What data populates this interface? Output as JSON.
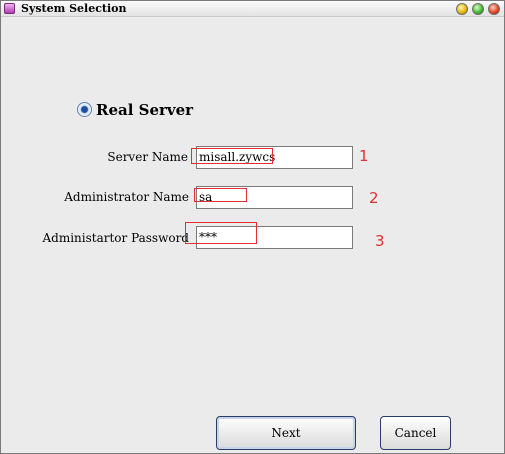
{
  "window": {
    "title": "System Selection"
  },
  "server_option": {
    "label": "Real Server",
    "selected": true
  },
  "fields": [
    {
      "label": "Server Name",
      "value": "misall.zywcs",
      "marker": "1"
    },
    {
      "label": "Administrator Name",
      "value": "sa",
      "marker": "2"
    },
    {
      "label": "Administartor Password",
      "value": "***",
      "marker": "3"
    }
  ],
  "buttons": {
    "next": "Next",
    "cancel": "Cancel"
  },
  "colors": {
    "annotation": "#e03030",
    "radio_dot": "#1e4f9e"
  }
}
